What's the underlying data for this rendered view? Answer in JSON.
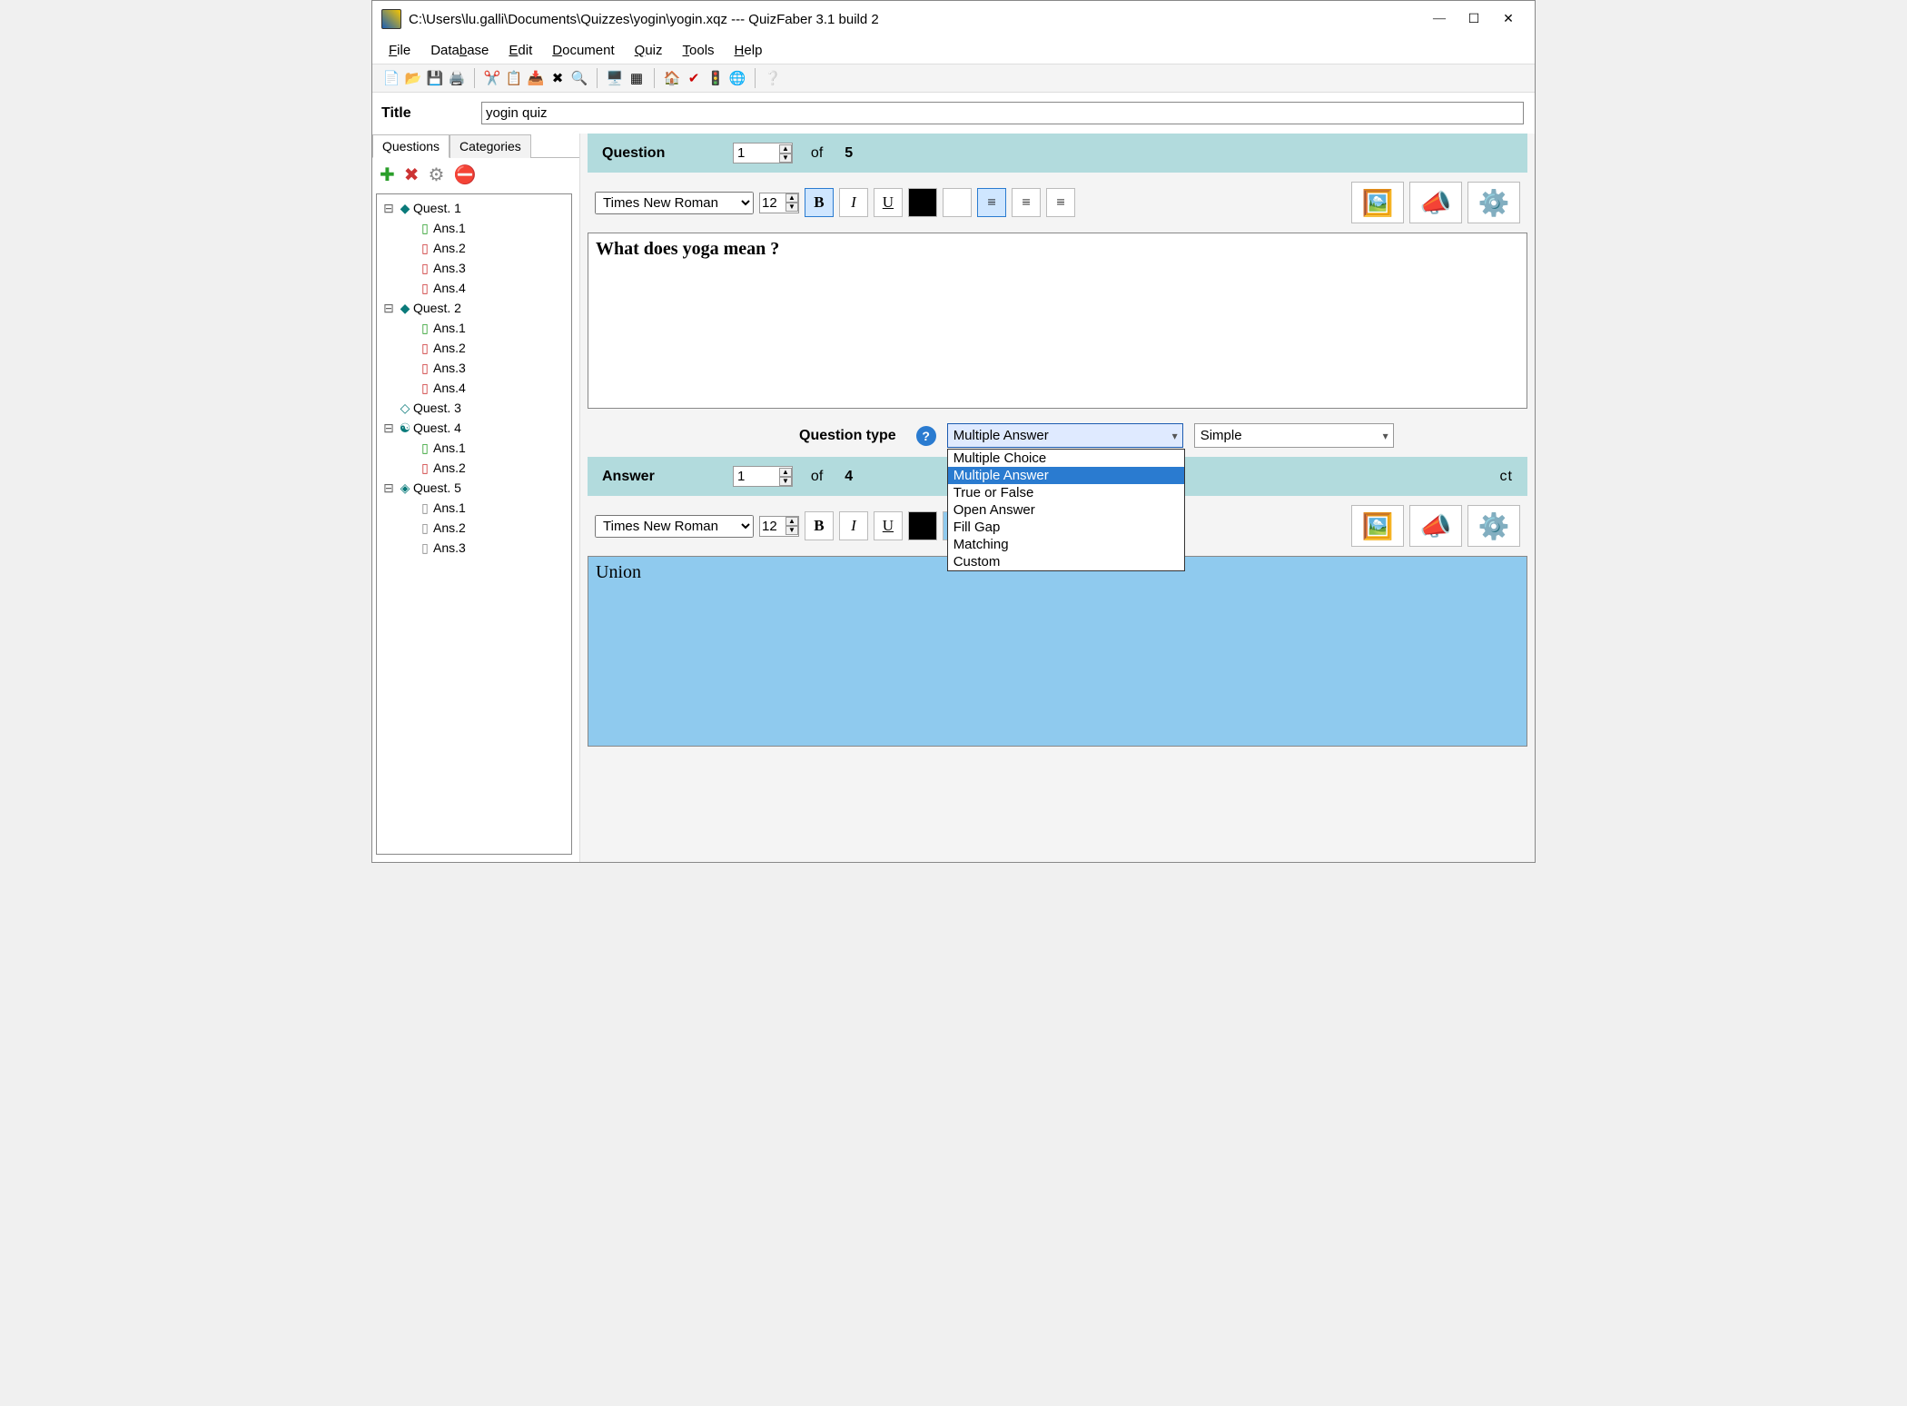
{
  "window": {
    "title": "C:\\Users\\lu.galli\\Documents\\Quizzes\\yogin\\yogin.xqz  ---  QuizFaber 3.1 build 2"
  },
  "menu": {
    "file": "File",
    "database": "Database",
    "edit": "Edit",
    "document": "Document",
    "quiz": "Quiz",
    "tools": "Tools",
    "help": "Help"
  },
  "titlerow": {
    "label": "Title",
    "value": "yogin quiz"
  },
  "tabs": {
    "questions": "Questions",
    "categories": "Categories"
  },
  "tree": [
    {
      "label": "Quest. 1",
      "type": "q",
      "ans": [
        {
          "label": "Ans.1",
          "c": "g"
        },
        {
          "label": "Ans.2",
          "c": "r"
        },
        {
          "label": "Ans.3",
          "c": "r"
        },
        {
          "label": "Ans.4",
          "c": "r"
        }
      ]
    },
    {
      "label": "Quest. 2",
      "type": "q",
      "ans": [
        {
          "label": "Ans.1",
          "c": "g"
        },
        {
          "label": "Ans.2",
          "c": "r"
        },
        {
          "label": "Ans.3",
          "c": "r"
        },
        {
          "label": "Ans.4",
          "c": "r"
        }
      ]
    },
    {
      "label": "Quest. 3",
      "type": "q",
      "ans": []
    },
    {
      "label": "Quest. 4",
      "type": "q",
      "ans": [
        {
          "label": "Ans.1",
          "c": "g"
        },
        {
          "label": "Ans.2",
          "c": "r"
        }
      ]
    },
    {
      "label": "Quest. 5",
      "type": "q",
      "ans": [
        {
          "label": "Ans.1",
          "c": "p"
        },
        {
          "label": "Ans.2",
          "c": "p"
        },
        {
          "label": "Ans.3",
          "c": "p"
        }
      ]
    }
  ],
  "question": {
    "band_label": "Question",
    "index": "1",
    "of": "of",
    "total": "5",
    "font": "Times New Roman",
    "size": "12",
    "text": "What does yoga mean ?"
  },
  "qtype": {
    "label": "Question type",
    "selected": "Multiple Answer",
    "options": [
      "Multiple Choice",
      "Multiple Answer",
      "True or False",
      "Open Answer",
      "Fill Gap",
      "Matching",
      "Custom"
    ],
    "subtype": "Simple"
  },
  "answer": {
    "band_label": "Answer",
    "index": "1",
    "of": "of",
    "total": "4",
    "correct_label": "ct",
    "font": "Times New Roman",
    "size": "12",
    "text": "Union"
  },
  "colors": {
    "black": "#000000",
    "white": "#ffffff",
    "ans": "#8fcaee"
  }
}
